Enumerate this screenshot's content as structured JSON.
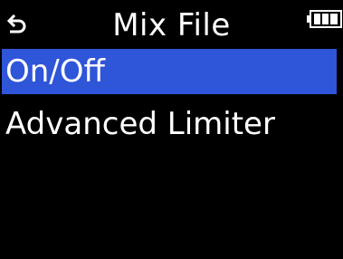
{
  "header": {
    "title": "Mix File",
    "back_icon": "back-arrow-icon",
    "battery_icon": "battery-icon"
  },
  "menu": {
    "items": [
      {
        "label": "On/Off",
        "selected": true
      },
      {
        "label": "Advanced Limiter",
        "selected": false
      }
    ]
  },
  "colors": {
    "background": "#000000",
    "text": "#ffffff",
    "selection": "#2f55d8"
  }
}
